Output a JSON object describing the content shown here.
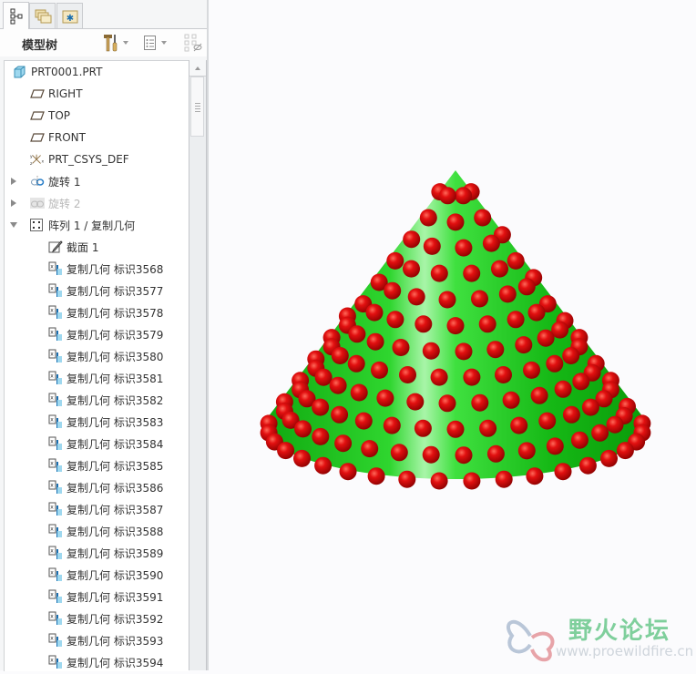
{
  "tabs": [
    {
      "name": "model-tree-tab",
      "icon": "tree-icon",
      "active": true
    },
    {
      "name": "folder-browser-tab",
      "icon": "folders-icon",
      "active": false
    },
    {
      "name": "favorites-tab",
      "icon": "star-folder-icon",
      "active": false
    }
  ],
  "toolbar": {
    "title": "模型树",
    "settings_icon": "hammer-screwdriver-icon",
    "show_icon": "list-icon",
    "filter_icon": "tree-filter-icon"
  },
  "tree": {
    "root": "PRT0001.PRT",
    "items": [
      {
        "label": "RIGHT",
        "icon": "datum-plane-icon"
      },
      {
        "label": "TOP",
        "icon": "datum-plane-icon"
      },
      {
        "label": "FRONT",
        "icon": "datum-plane-icon"
      },
      {
        "label": "PRT_CSYS_DEF",
        "icon": "csys-icon"
      },
      {
        "label": "旋转 1",
        "icon": "revolve-icon",
        "expander": "collapsed"
      },
      {
        "label": "旋转 2",
        "icon": "revolve-icon",
        "expander": "collapsed",
        "suppressed": true
      },
      {
        "label": "阵列 1 / 复制几何",
        "icon": "pattern-icon",
        "expander": "expanded"
      },
      {
        "label": "截面 1",
        "icon": "sketch-icon"
      }
    ],
    "copy_geom_prefix": "复制几何 标识",
    "copy_geom_ids": [
      "3568",
      "3577",
      "3578",
      "3579",
      "3580",
      "3581",
      "3582",
      "3583",
      "3584",
      "3585",
      "3586",
      "3587",
      "3588",
      "3589",
      "3590",
      "3591",
      "3592",
      "3593",
      "3594"
    ]
  },
  "viewport": {
    "model": "cone-with-sphere-pattern",
    "cone_color": "#22cc22",
    "sphere_color": "#dd0000"
  },
  "watermark": {
    "title": "野火论坛",
    "url": "www.proewildfire.cn"
  }
}
